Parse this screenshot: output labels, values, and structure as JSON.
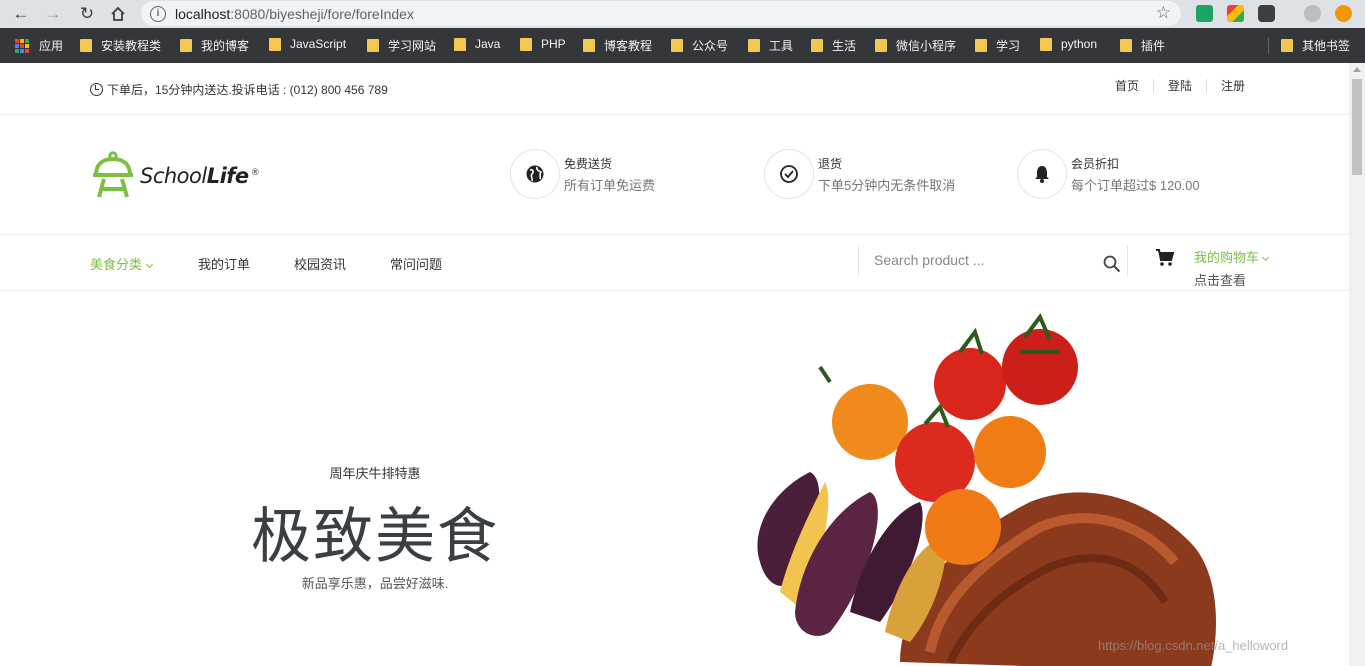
{
  "browser": {
    "url_host": "localhost",
    "url_path": ":8080/biyesheji/fore/foreIndex",
    "bookmarks": [
      "应用",
      "安装教程类",
      "我的博客",
      "JavaScript",
      "学习网站",
      "Java",
      "PHP",
      "博客教程",
      "公众号",
      "工具",
      "生活",
      "微信小程序",
      "学习",
      "python",
      "插件"
    ],
    "other_bookmarks": "其他书签"
  },
  "topbar": {
    "notice": "下单后，15分钟内送达.投诉电话 : (012) 800 456 789",
    "links": [
      "首页",
      "登陆",
      "注册"
    ]
  },
  "logo": {
    "part1": "School",
    "part2": "Life",
    "reg": "®"
  },
  "features": [
    {
      "icon": "globe-icon",
      "title": "免费送货",
      "sub": "所有订单免运费"
    },
    {
      "icon": "check-circle-icon",
      "title": "退货",
      "sub": "下单5分钟内无条件取消"
    },
    {
      "icon": "bell-icon",
      "title": "会员折扣",
      "sub": "每个订单超过$ 120.00"
    }
  ],
  "nav": {
    "items": [
      "美食分类",
      "我的订单",
      "校园资讯",
      "常问问题"
    ]
  },
  "search": {
    "placeholder": "Search product ..."
  },
  "cart": {
    "title": "我的购物车",
    "sub": "点击查看"
  },
  "hero": {
    "kicker": "周年庆牛排特惠",
    "headline": "极致美食",
    "tagline": "新品享乐惠，品尝好滋味."
  },
  "watermark": "https://blog.csdn.net/a_helloword",
  "colors": {
    "accent": "#7ac143",
    "chrome": "#dee1e6",
    "bookmarks_bar": "#35363a"
  }
}
